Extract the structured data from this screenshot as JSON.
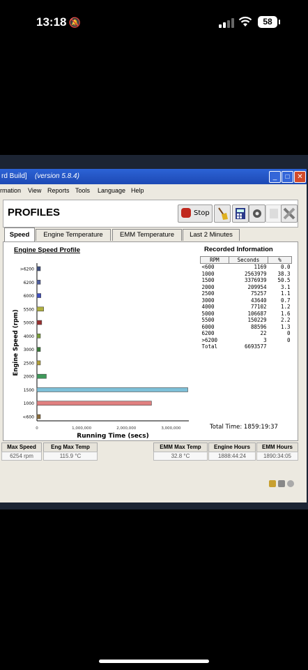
{
  "status": {
    "time": "13:18",
    "battery": "58"
  },
  "window": {
    "title_left": "rd Build]",
    "version": "(version 5.8.4)"
  },
  "menu": [
    "rmation",
    "View",
    "Reports",
    "Tools",
    "Language",
    "Help"
  ],
  "header": {
    "title": "PROFILES",
    "stop_label": "Stop"
  },
  "tabs": [
    "Speed",
    "Engine Temperature",
    "EMM Temperature",
    "Last 2 Minutes"
  ],
  "chart_data": {
    "type": "bar",
    "orientation": "horizontal",
    "title": "Engine Speed Profile",
    "xlabel": "Running Time (secs)",
    "ylabel": "Engine Speed (rpm)",
    "categories": [
      "<600",
      "1000",
      "1500",
      "2000",
      "2500",
      "3000",
      "4000",
      "5000",
      "5500",
      "6000",
      "6200",
      ">6200"
    ],
    "values": [
      1169,
      2563979,
      3376939,
      209954,
      75257,
      43640,
      77102,
      106687,
      150229,
      88596,
      22,
      3
    ],
    "colors": [
      "#8a6d3b",
      "#e08080",
      "#7ec0d8",
      "#3e9a5a",
      "#b3a13a",
      "#3a7a3a",
      "#7aa03a",
      "#9a3030",
      "#b0b040",
      "#4050c0",
      "#5060a0",
      "#405080"
    ],
    "xlim": [
      0,
      3400000
    ],
    "xticks": [
      "0",
      "1,000,000",
      "2,000,000",
      "3,000,000"
    ]
  },
  "recorded": {
    "title": "Recorded Information",
    "headers": [
      "RPM",
      "Seconds",
      "%"
    ],
    "rows": [
      [
        "<600",
        "1169",
        "0.0"
      ],
      [
        "1000",
        "2563979",
        "38.3"
      ],
      [
        "1500",
        "3376939",
        "50.5"
      ],
      [
        "2000",
        "209954",
        "3.1"
      ],
      [
        "2500",
        "75257",
        "1.1"
      ],
      [
        "3000",
        "43640",
        "0.7"
      ],
      [
        "4000",
        "77102",
        "1.2"
      ],
      [
        "5000",
        "106687",
        "1.6"
      ],
      [
        "5500",
        "150229",
        "2.2"
      ],
      [
        "6000",
        "88596",
        "1.3"
      ],
      [
        "6200",
        "22",
        "0"
      ],
      [
        ">6200",
        "3",
        "0"
      ],
      [
        "Total",
        "6693577",
        ""
      ]
    ],
    "total_time": "Total Time: 1859:19:37"
  },
  "stats": {
    "max_speed_label": "Max Speed",
    "max_speed": "6254 rpm",
    "eng_max_temp_label": "Eng Max Temp",
    "eng_max_temp": "115.9 °C",
    "emm_max_temp_label": "EMM Max Temp",
    "emm_max_temp": "32.8 °C",
    "engine_hours_label": "Engine Hours",
    "engine_hours": "1888:44:24",
    "emm_hours_label": "EMM Hours",
    "emm_hours": "1890:34:05"
  }
}
